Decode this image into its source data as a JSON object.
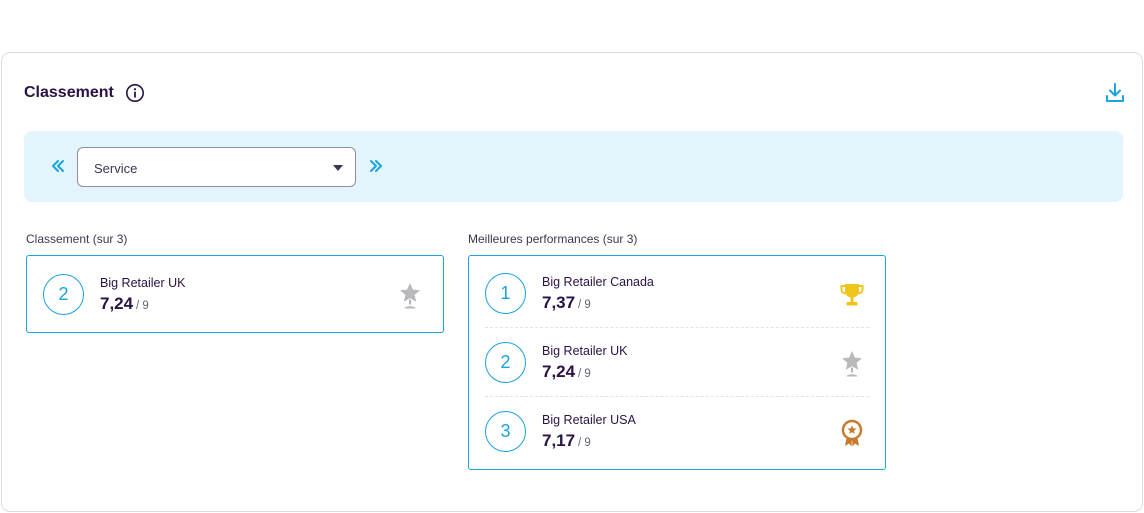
{
  "card": {
    "title": "Classement",
    "info_icon": "info-icon",
    "download_icon": "download-icon"
  },
  "filter": {
    "prev_icon": "double-chevron-left-icon",
    "next_icon": "double-chevron-right-icon",
    "selected": "Service"
  },
  "ranking": {
    "label": "Classement (sur 3)",
    "rows": [
      {
        "rank": "2",
        "name": "Big Retailer UK",
        "score": "7,24",
        "max": "/ 9",
        "badge": "silver-star-icon"
      }
    ]
  },
  "top": {
    "label": "Meilleures performances (sur 3)",
    "rows": [
      {
        "rank": "1",
        "name": "Big Retailer Canada",
        "score": "7,37",
        "max": "/ 9",
        "badge": "gold-trophy-icon"
      },
      {
        "rank": "2",
        "name": "Big Retailer UK",
        "score": "7,24",
        "max": "/ 9",
        "badge": "silver-star-icon"
      },
      {
        "rank": "3",
        "name": "Big Retailer USA",
        "score": "7,17",
        "max": "/ 9",
        "badge": "bronze-medal-icon"
      }
    ]
  },
  "colors": {
    "accent": "#1aa3dc",
    "text": "#2a1245",
    "filter_bg": "#e3f4fd",
    "gold": "#f0c419",
    "silver": "#b8b8bd",
    "bronze": "#c87a2c"
  }
}
